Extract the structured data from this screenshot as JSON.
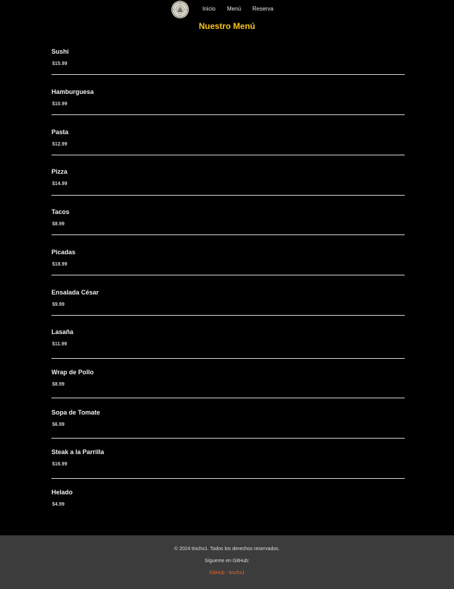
{
  "nav": {
    "logo_icon": "seal-logo-icon",
    "links": [
      "Inicio",
      "Menú",
      "Reserva"
    ]
  },
  "title": "Nuestro Menú",
  "menu": [
    {
      "name": "Sushi",
      "price": "$15.99"
    },
    {
      "name": "Hamburguesa",
      "price": "$10.99"
    },
    {
      "name": "Pasta",
      "price": "$12.99"
    },
    {
      "name": "Pizza",
      "price": "$14.99"
    },
    {
      "name": "Tacos",
      "price": "$8.99"
    },
    {
      "name": "Picadas",
      "price": "$18.99"
    },
    {
      "name": "Ensalada César",
      "price": "$9.99"
    },
    {
      "name": "Lasaña",
      "price": "$11.99"
    },
    {
      "name": "Wrap de Pollo",
      "price": "$8.99"
    },
    {
      "name": "Sopa de Tomate",
      "price": "$6.99"
    },
    {
      "name": "Steak a la Parrilla",
      "price": "$16.99"
    },
    {
      "name": "Helado",
      "price": "$4.99"
    }
  ],
  "footer": {
    "copyright": "© 2024 tinchx1. Todos los derechos reservados.",
    "follow": "Sígueme en GitHub:",
    "link": "GitHub - tinchx1"
  },
  "colors": {
    "background": "#000000",
    "accent": "#f7c51e",
    "footer_bg": "#3c3c3c",
    "link": "#e8692a"
  }
}
